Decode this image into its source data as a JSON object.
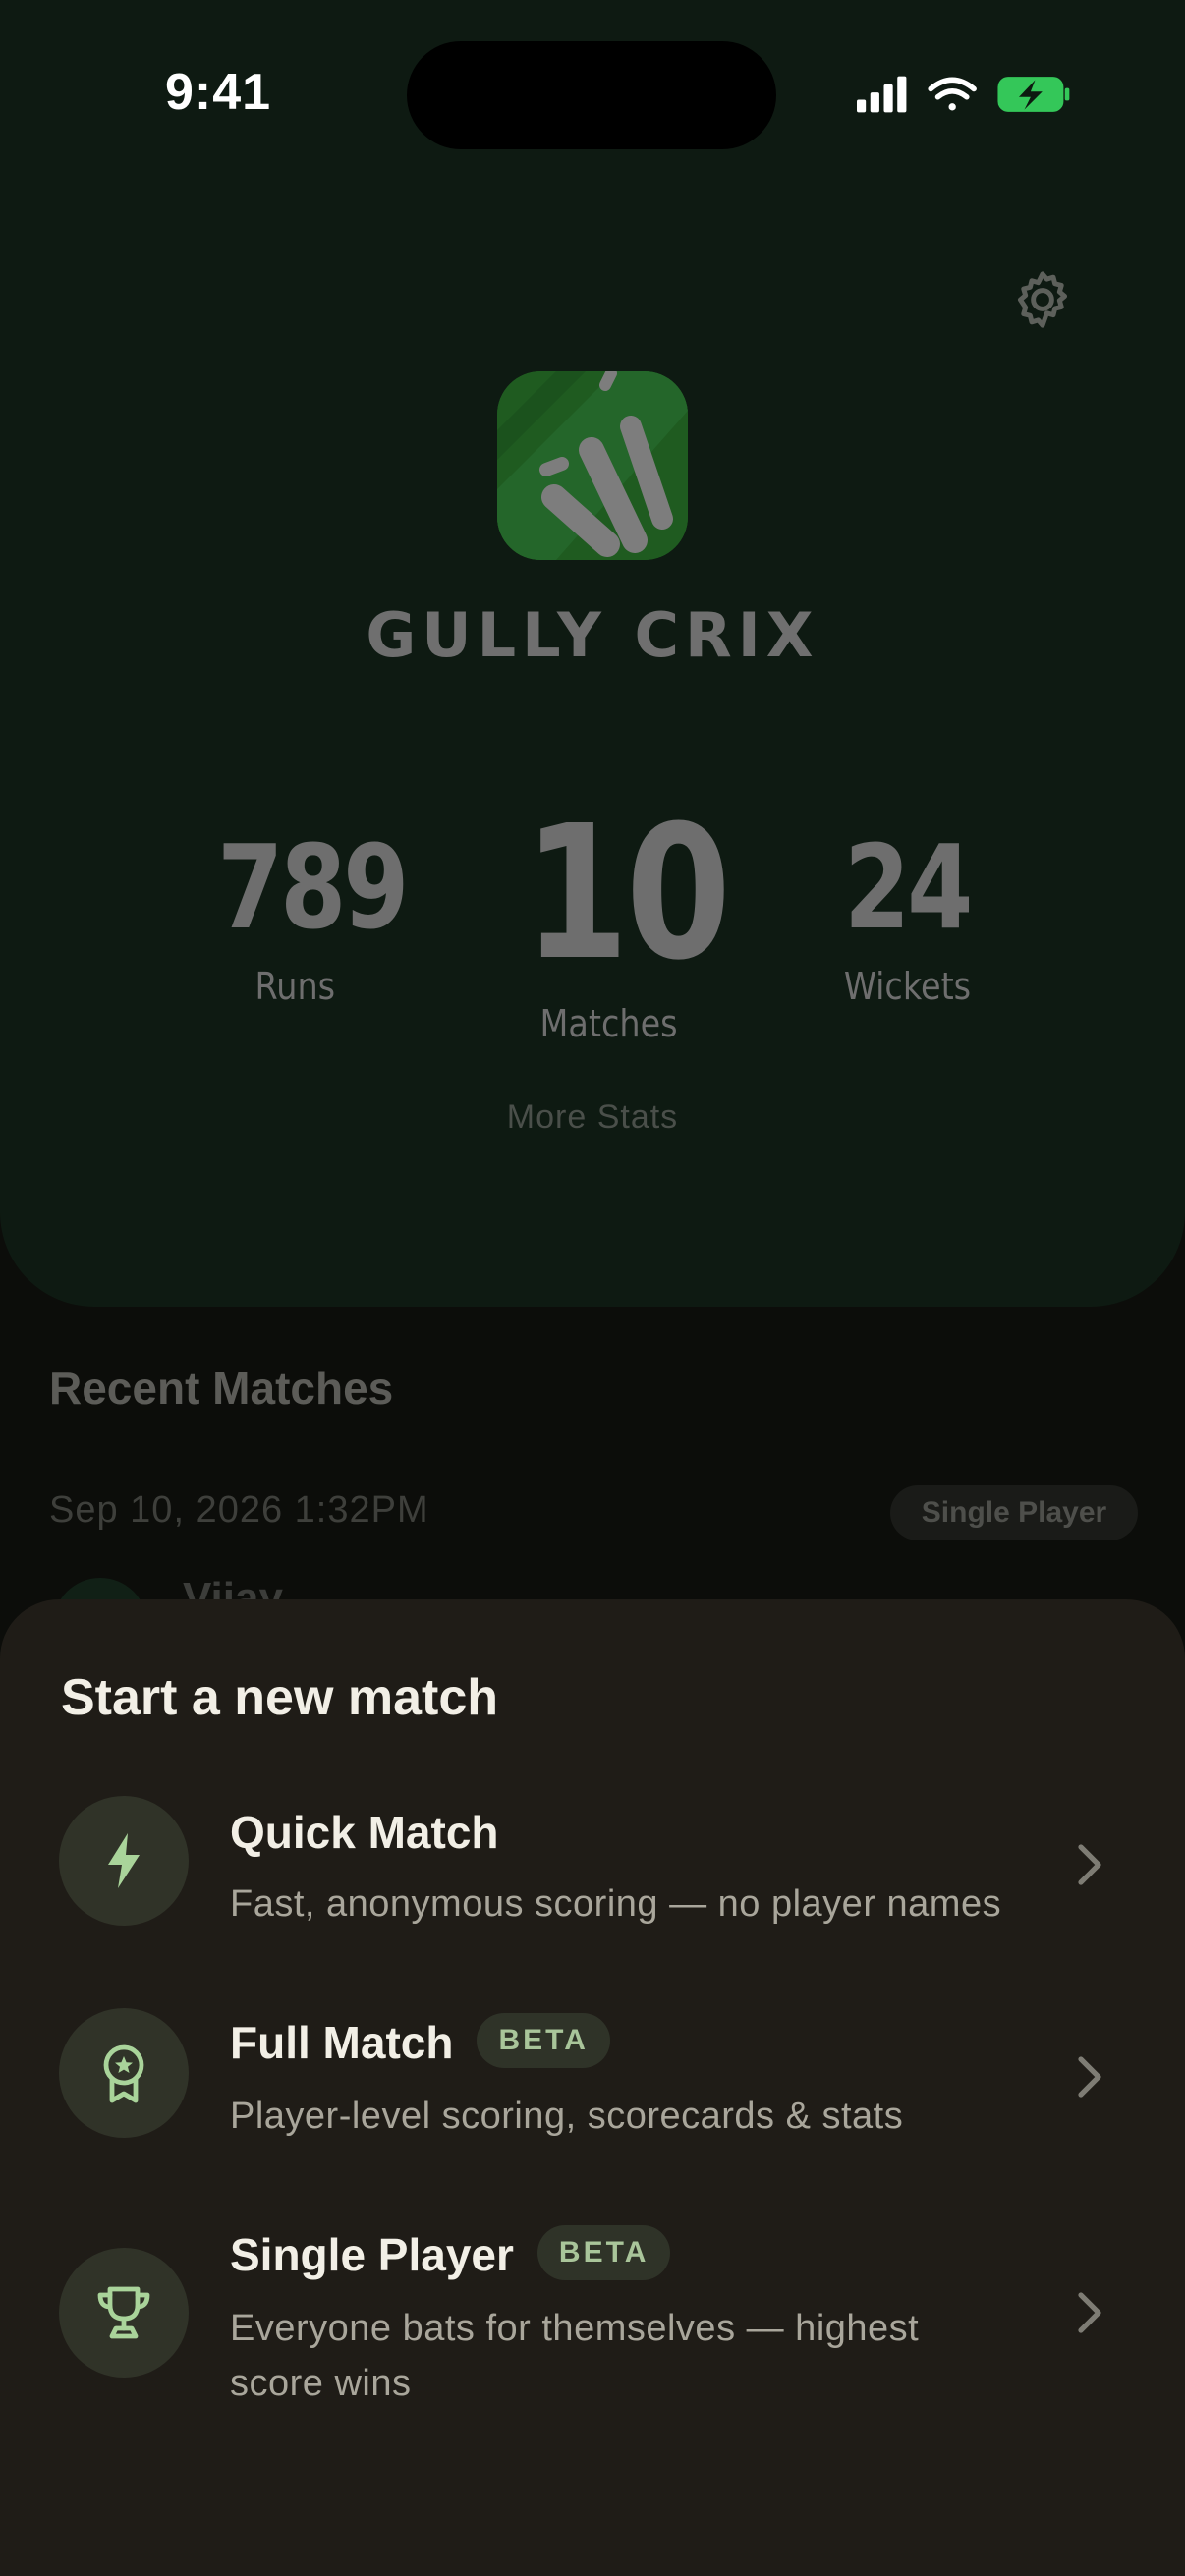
{
  "status_bar": {
    "time": "9:41"
  },
  "app": {
    "name": "GULLY CRIX"
  },
  "stats": {
    "runs": {
      "value": "789",
      "label": "Runs"
    },
    "matches": {
      "value": "10",
      "label": "Matches"
    },
    "wickets": {
      "value": "24",
      "label": "Wickets"
    },
    "more_label": "More Stats"
  },
  "recent": {
    "title": "Recent Matches",
    "items": [
      {
        "date": "Sep 10, 2026 1:32PM",
        "badge": "Single Player",
        "player": "Vijay"
      }
    ]
  },
  "sheet": {
    "title": "Start a new match",
    "options": [
      {
        "icon": "lightning-icon",
        "title": "Quick Match",
        "badge": "",
        "description": "Fast, anonymous scoring — no player names"
      },
      {
        "icon": "award-medal-icon",
        "title": "Full Match",
        "badge": "BETA",
        "description": "Player-level scoring, scorecards & stats"
      },
      {
        "icon": "trophy-icon",
        "title": "Single Player",
        "badge": "BETA",
        "description": "Everyone bats for themselves — highest score wins"
      }
    ]
  },
  "colors": {
    "hero_bg": "#0e1a12",
    "sheet_bg": "#1f1c17",
    "accent_green": "#a9d49a",
    "logo_green": "#1f5b20",
    "battery_green": "#34c759"
  }
}
